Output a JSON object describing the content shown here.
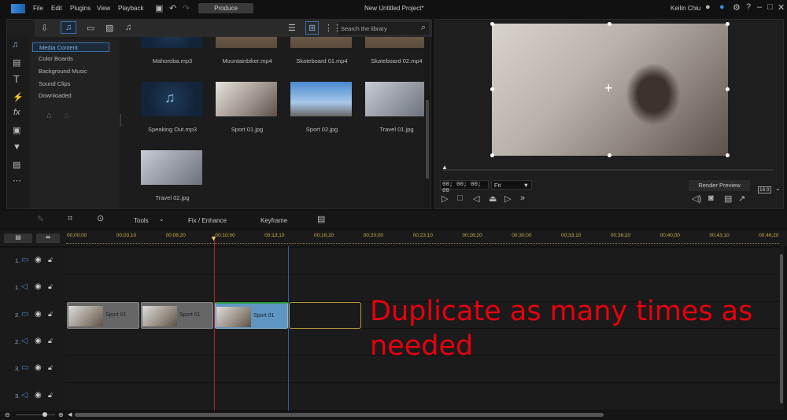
{
  "menu": {
    "items": [
      "File",
      "Edit",
      "Plugins",
      "View",
      "Playback"
    ],
    "produce": "Produce",
    "project_title": "New Untitled Project*",
    "user": "Keilin Chiu"
  },
  "library": {
    "search_placeholder": "Search the library",
    "categories": [
      "Media Content",
      "Color Boards",
      "Background Music",
      "Sound Clips",
      "Downloaded"
    ],
    "media": [
      {
        "name": "Mahoroba.mp3",
        "type": "audio"
      },
      {
        "name": "Mountainbiker.mp4",
        "type": "video"
      },
      {
        "name": "Skateboard 01.mp4",
        "type": "video"
      },
      {
        "name": "Skateboard 02.mp4",
        "type": "video"
      },
      {
        "name": "Speaking Out.mp3",
        "type": "audio"
      },
      {
        "name": "Sport 01.jpg",
        "type": "image"
      },
      {
        "name": "Sport 02.jpg",
        "type": "image"
      },
      {
        "name": "Travel 01.jpg",
        "type": "image"
      },
      {
        "name": "Travel 02.jpg",
        "type": "image"
      }
    ]
  },
  "preview": {
    "timecode": "00; 00; 00; 00",
    "fit": "Fit",
    "render_preview": "Render Preview",
    "aspect": "16:9"
  },
  "toolbar": {
    "tools": "Tools",
    "fix_enhance": "Fix / Enhance",
    "keyframe": "Keyframe"
  },
  "ruler": [
    "00;00;00",
    "00;03;10",
    "00;06;20",
    "00;10;00",
    "00;13;10",
    "00;16;20",
    "00;20;00",
    "00;23;10",
    "00;26;20",
    "00;30;00",
    "00;33;10",
    "00;36;20",
    "00;40;00",
    "00;43;10",
    "00;46;20"
  ],
  "tracks": [
    "1.",
    "1.",
    "2.",
    "2.",
    "3.",
    "3."
  ],
  "clips": [
    "Sport 01",
    "Sport 01",
    "Sport 01"
  ],
  "annotation": {
    "line1": "Duplicate as many times as",
    "line2": "needed"
  }
}
